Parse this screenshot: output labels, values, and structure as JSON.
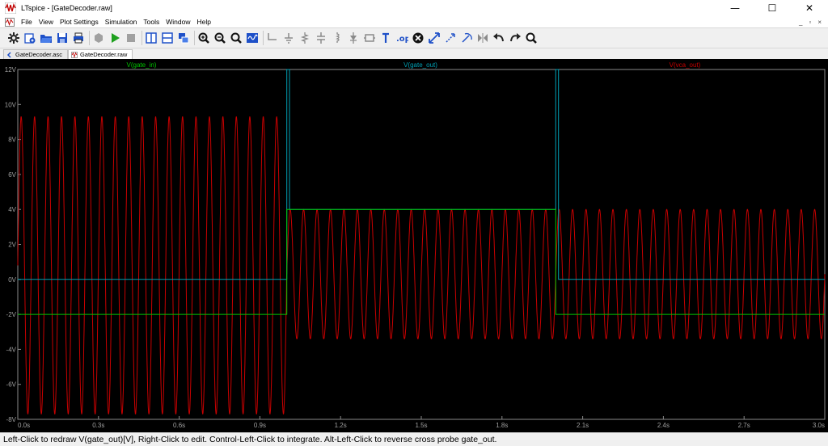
{
  "window": {
    "title": "LTspice - [GateDecoder.raw]",
    "minimize_glyph": "—",
    "maximize_glyph": "☐",
    "close_glyph": "✕"
  },
  "menu": {
    "items": [
      "File",
      "View",
      "Plot Settings",
      "Simulation",
      "Tools",
      "Window",
      "Help"
    ],
    "mdi_minimize": "_",
    "mdi_restore": "▫",
    "mdi_close": "×"
  },
  "toolbar": {
    "icons": [
      "gear-icon",
      "open-icon",
      "open-folder-icon",
      "save-icon",
      "print-icon",
      "hexagon-icon",
      "run-icon",
      "stop-icon",
      "tile-vertical-icon",
      "tile-horizontal-icon",
      "cascade-icon",
      "zoom-in-icon",
      "zoom-out-icon",
      "zoom-fit-icon",
      "autorange-icon",
      "wire-icon",
      "ground-icon",
      "resistor-icon",
      "capacitor-icon",
      "inductor-icon",
      "diode-icon",
      "component-icon",
      "text-icon",
      "spice-directive-icon",
      "delete-icon",
      "move-icon",
      "drag-icon",
      "rotate-icon",
      "mirror-icon",
      "undo-icon",
      "redo-icon",
      "find-icon"
    ]
  },
  "tabs": [
    {
      "label": "GateDecoder.asc",
      "active": false
    },
    {
      "label": "GateDecoder.raw",
      "active": true
    }
  ],
  "colors": {
    "gate_in": "#00c800",
    "gate_out": "#00a0b4",
    "vca_out": "#c80000",
    "axis_text": "#a0a0a0",
    "grid": "#303030"
  },
  "chart_data": {
    "type": "line",
    "title": "",
    "xlabel": "",
    "ylabel": "",
    "xlim": [
      0,
      3.0
    ],
    "ylim": [
      -8,
      12
    ],
    "x_ticks": [
      "0.0s",
      "0.3s",
      "0.6s",
      "0.9s",
      "1.2s",
      "1.5s",
      "1.8s",
      "2.1s",
      "2.4s",
      "2.7s",
      "3.0s"
    ],
    "y_ticks": [
      "12V",
      "10V",
      "8V",
      "6V",
      "4V",
      "2V",
      "0V",
      "-2V",
      "-4V",
      "-6V",
      "-8V"
    ],
    "legend_placement": "top",
    "series": [
      {
        "name": "V(gate_in)",
        "kind": "step",
        "points": [
          [
            0,
            -2
          ],
          [
            1.0,
            -2
          ],
          [
            1.0,
            4
          ],
          [
            2.0,
            4
          ],
          [
            2.0,
            -2
          ],
          [
            3.0,
            -2
          ]
        ]
      },
      {
        "name": "V(gate_out)",
        "kind": "step",
        "points": [
          [
            0,
            0
          ],
          [
            1.0,
            0
          ],
          [
            1.0,
            12
          ],
          [
            1.01,
            12
          ],
          [
            1.01,
            4
          ],
          [
            2.0,
            4
          ],
          [
            2.0,
            12
          ],
          [
            2.01,
            12
          ],
          [
            2.01,
            0
          ],
          [
            3.0,
            0
          ]
        ]
      },
      {
        "name": "V(vca_out)",
        "kind": "sine",
        "frequency_hz": 20,
        "segments": [
          {
            "t_start": 0,
            "t_end": 1.0,
            "offset": 0.8,
            "amplitude": 8.5
          },
          {
            "t_start": 1.0,
            "t_end": 2.0,
            "offset": 0.3,
            "amplitude": 3.7
          },
          {
            "t_start": 2.0,
            "t_end": 3.0,
            "offset": 0.3,
            "amplitude": 3.7
          }
        ]
      }
    ]
  },
  "status": {
    "text": "Left-Click to redraw V(gate_out)[V],  Right-Click to edit. Control-Left-Click to integrate. Alt-Left-Click to reverse cross probe gate_out."
  }
}
